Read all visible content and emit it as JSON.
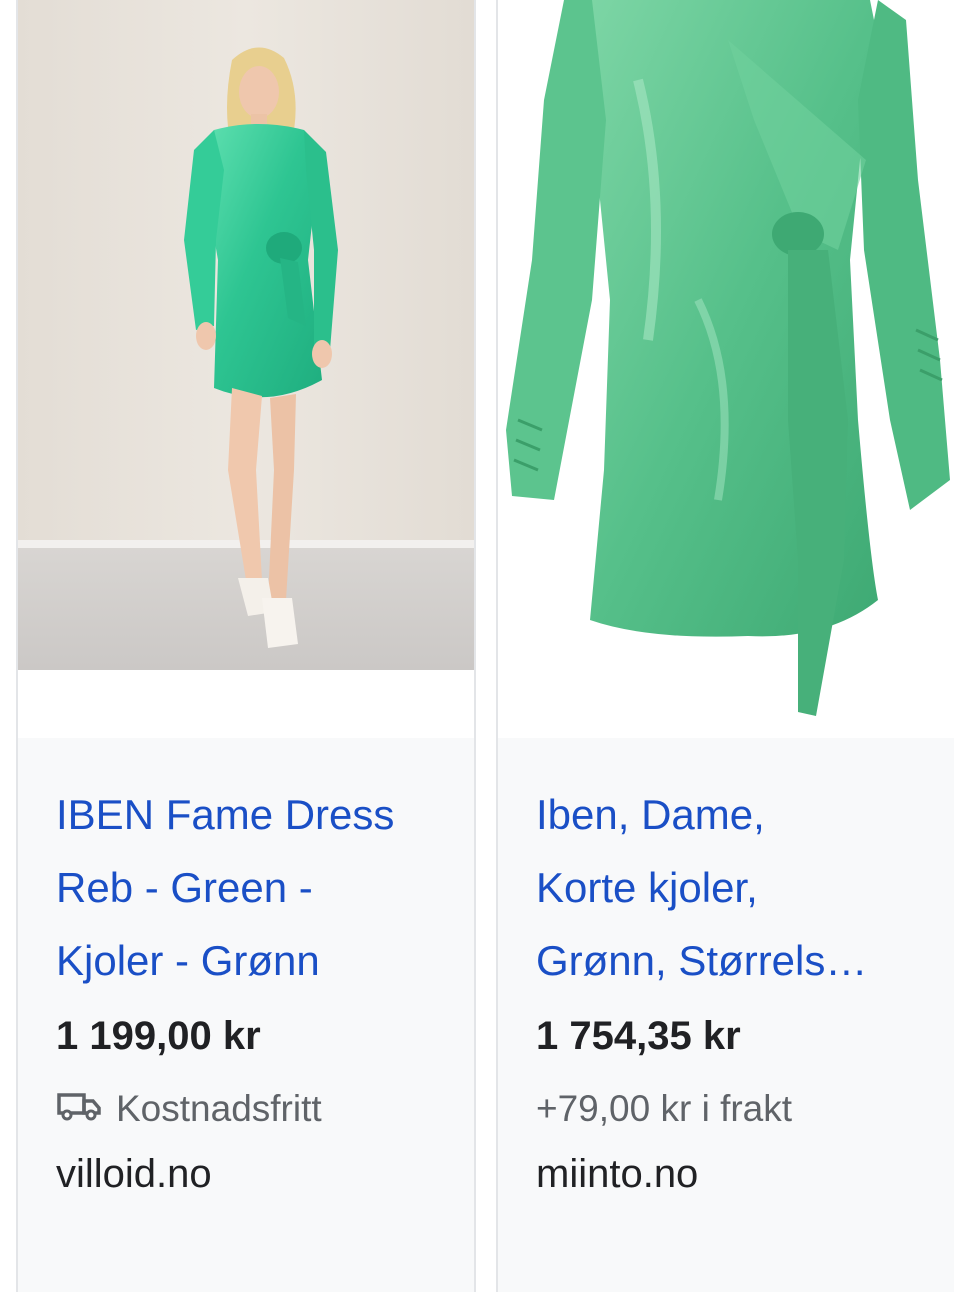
{
  "results": [
    {
      "title_lines": [
        "IBEN Fame Dress",
        "Reb - Green -",
        "Kjoler - Grønn"
      ],
      "price": "1 199,00 kr",
      "shipping_icon": "truck-icon",
      "shipping": "Kostnadsfritt",
      "store": "villoid.no"
    },
    {
      "title_lines": [
        "Iben, Dame,",
        "Korte kjoler,",
        "Grønn, Størrels…"
      ],
      "price": "1 754,35 kr",
      "shipping": "+79,00 kr i frakt",
      "store": "miinto.no"
    }
  ],
  "colors": {
    "link_blue": "#1a4fc6",
    "dress_green": "#3fcf9a",
    "dress_green_product": "#5cc48e",
    "card_bg": "#f8f9fa"
  }
}
